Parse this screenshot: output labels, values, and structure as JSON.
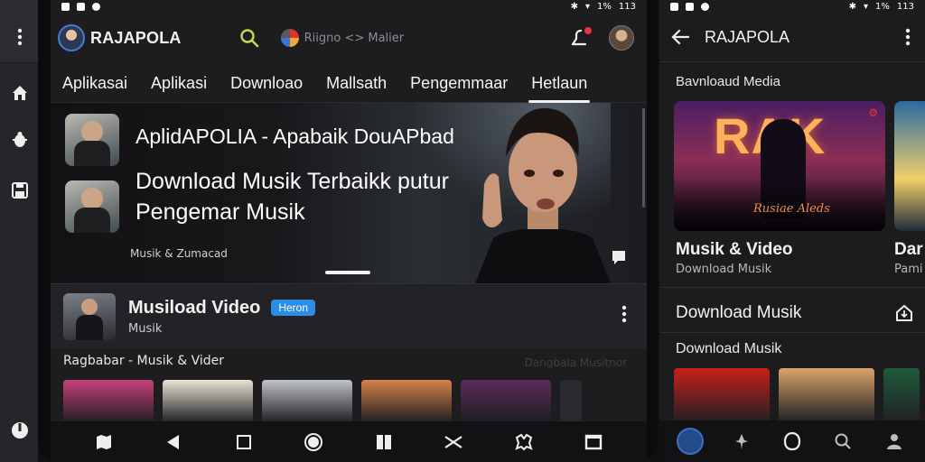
{
  "status_left": {
    "time": "113",
    "battery": "1%"
  },
  "status_right": {
    "time": "113",
    "battery": "1%"
  },
  "left_phone": {
    "brand": "RAJAPOLA",
    "language_label": "Riigno <> Malier",
    "tabs": [
      "Aplikasai",
      "Aplikasi",
      "Downloao",
      "Mallsath",
      "Pengemmaar",
      "Hetlaun"
    ],
    "hero": {
      "title1": "AplidAPOLIA - Apabaik DouAPbad",
      "title2": "Download Musik Terbaikk putur Pengemar Musik",
      "caption": "Musik & Zumacad"
    },
    "row": {
      "title": "Musiload Video",
      "badge": "Heron",
      "subtitle": "Musik"
    },
    "section_title": "Ragbabar - Musik & Vider",
    "section_right": "Dangbala Musitnor",
    "strip_colors": [
      "#c8407a",
      "#e9e2d6",
      "#bfc2c8",
      "#d6824a",
      "#5a2c58"
    ],
    "strip_peek_color": "#1d1d20"
  },
  "right_phone": {
    "title": "RAJAPOLA",
    "section1": "Bavnloaud Media",
    "card_big": {
      "art_text": "RAK",
      "sign": "Rusiae Aleds"
    },
    "card_title": "Musik & Video",
    "card_sub": "Download Musik",
    "card2_title": "Dar",
    "card2_sub": "Pami",
    "download_row": "Download Musik",
    "section2": "Download Musik",
    "strip_colors": [
      "#c7201a",
      "#d9a36a",
      "#1d5a3a"
    ]
  },
  "colors": {
    "accent_blue": "#2d8ce6",
    "notif_red": "#e5333b",
    "search_green": "#c6d850"
  }
}
